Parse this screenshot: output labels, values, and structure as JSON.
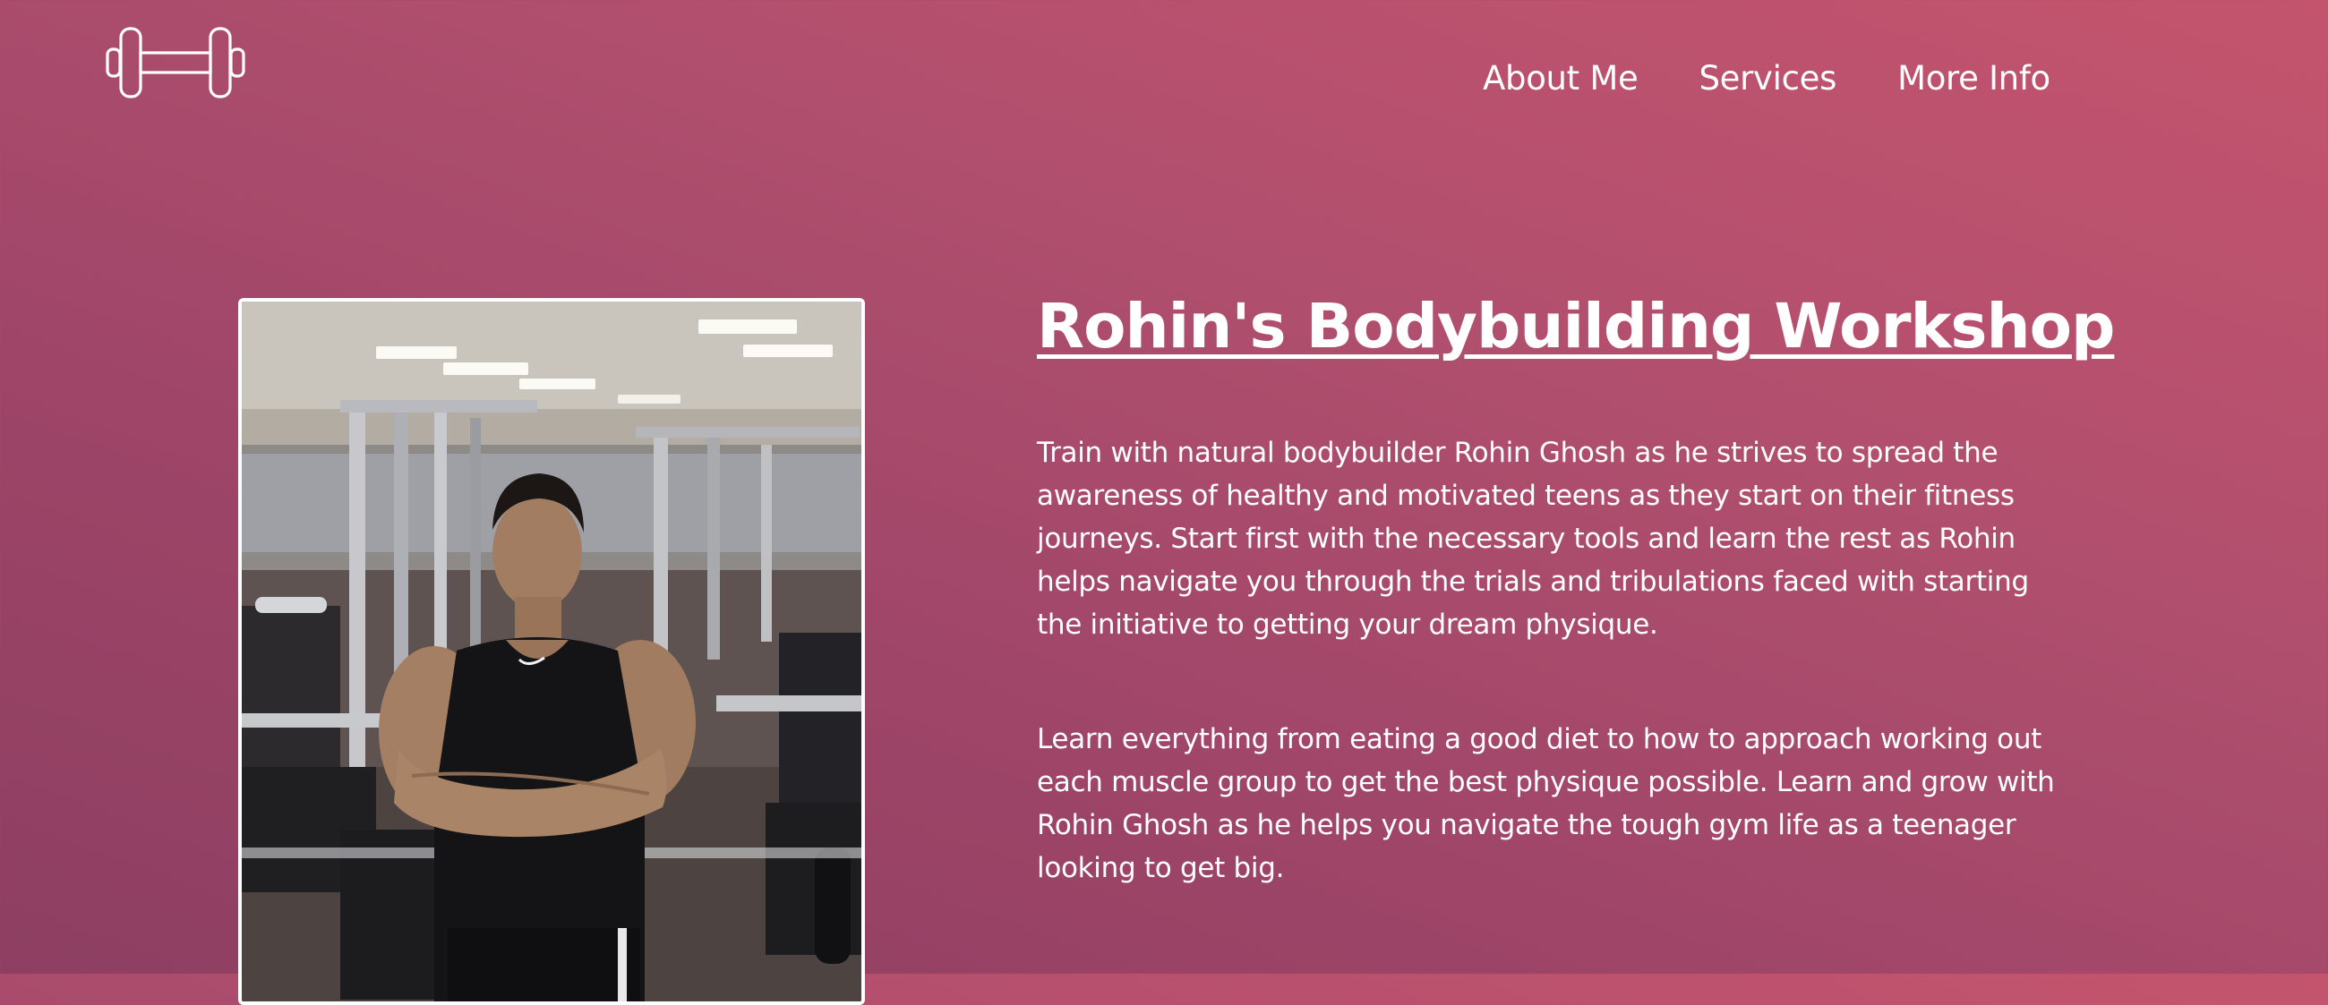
{
  "header": {
    "logo_icon": "dumbbell-icon",
    "nav": [
      {
        "label": "About Me"
      },
      {
        "label": "Services"
      },
      {
        "label": "More Info"
      }
    ]
  },
  "hero": {
    "title": "Rohin's Bodybuilding Workshop",
    "paragraphs": [
      "Train with natural bodybuilder Rohin Ghosh as he strives to spread the awareness of healthy and motivated teens as they start on their fitness journeys. Start first with the necessary tools and learn the rest as Rohin helps navigate you through the trials and tribulations faced with starting the initiative to getting your dream physique.",
      "Learn everything from eating a good diet to how to approach working out each muscle group to get the best physique possible. Learn and grow with Rohin Ghosh as he helps you navigate the tough gym life as a teenager looking to get big."
    ],
    "photo_subject": "gym-portrait-photo"
  },
  "colors": {
    "background_top": "#c4546d",
    "background_bottom": "#8d3f62",
    "text": "#ffffff"
  }
}
